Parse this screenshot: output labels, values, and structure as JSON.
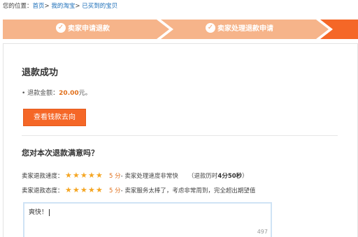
{
  "breadcrumb": {
    "prefix": "您的位置：",
    "items": [
      "首页",
      "我的淘宝",
      "已买到的宝贝"
    ],
    "sep": ">"
  },
  "steps": {
    "items": [
      "卖家申请退款",
      "卖家处理退款申请"
    ],
    "colors": {
      "done": "#f6b48a",
      "current": "#f56727"
    }
  },
  "result": {
    "title": "退款成功",
    "amount_label": "• 退款金额：",
    "amount_value": "20.00",
    "amount_unit": "元。",
    "button_label": "查看钱款去向"
  },
  "survey": {
    "question": "您对本次退款满意吗？",
    "rows": [
      {
        "label": "卖家退款速度：",
        "stars": 5,
        "score": "5 分",
        "desc": "- 卖家处理速度非常快",
        "extra_prefix": "（退款历时",
        "extra_value": "4分50秒",
        "extra_suffix": "）"
      },
      {
        "label": "卖家退款态度：",
        "stars": 5,
        "score": "5 分",
        "desc": "- 卖家服务太棒了，考虑非常周到，完全超出期望值"
      }
    ],
    "comment_value": "爽快！",
    "char_count": "497"
  }
}
